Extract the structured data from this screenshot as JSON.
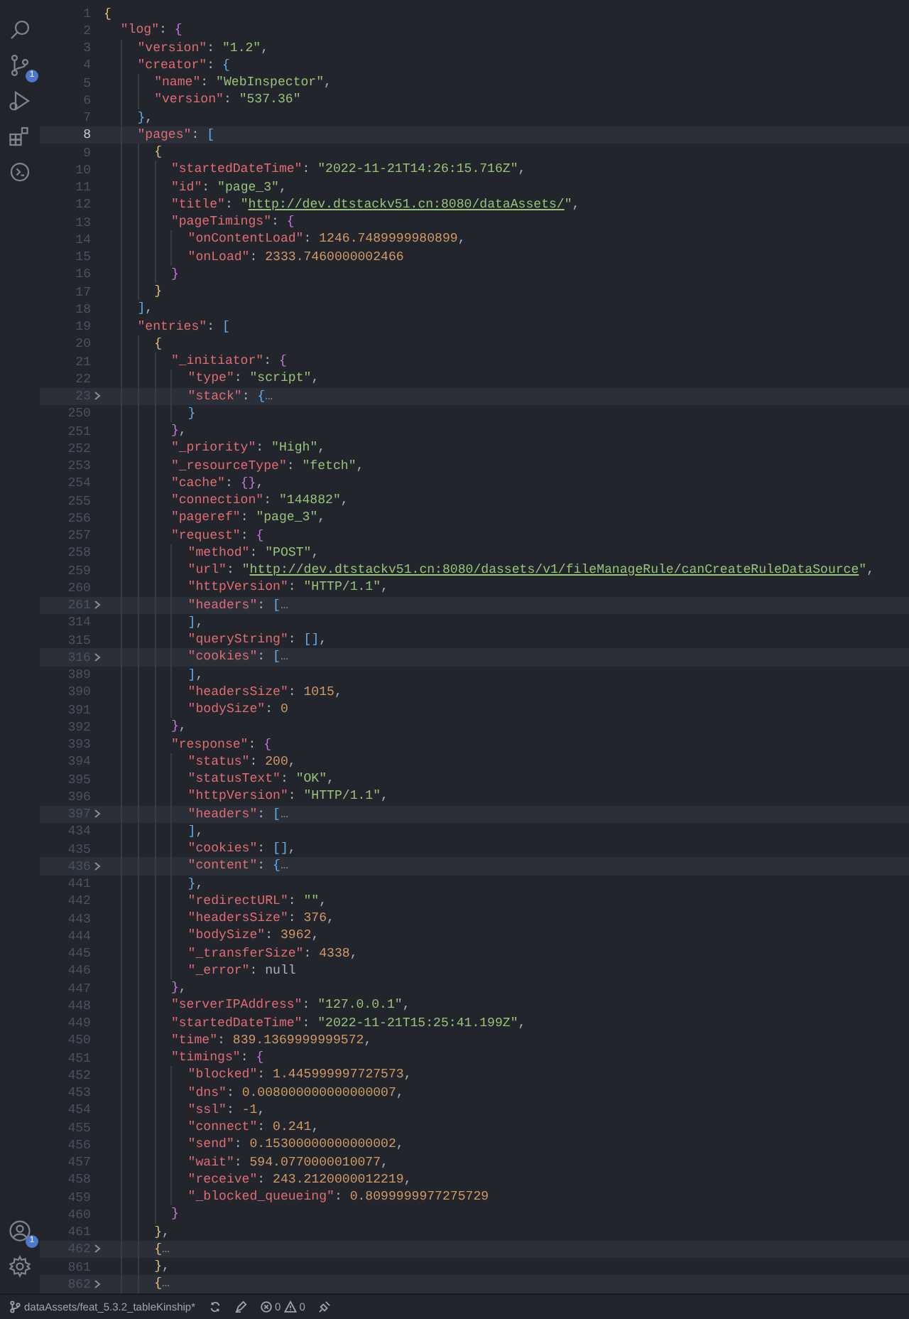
{
  "activity_bar": {
    "top": [
      {
        "kind": "search"
      },
      {
        "kind": "source-control",
        "badge": "1"
      },
      {
        "kind": "run-debug"
      },
      {
        "kind": "extensions"
      },
      {
        "kind": "remote"
      }
    ],
    "bottom": [
      {
        "kind": "account",
        "badge": "1"
      },
      {
        "kind": "settings"
      }
    ]
  },
  "editor": {
    "lines": [
      {
        "number": "1",
        "text": "{",
        "current": false,
        "folded": false
      },
      {
        "number": "2",
        "text": "  \"log\": {",
        "current": false,
        "folded": false
      },
      {
        "number": "3",
        "text": "    \"version\": \"1.2\",",
        "current": false,
        "folded": false
      },
      {
        "number": "4",
        "text": "    \"creator\": {",
        "current": false,
        "folded": false
      },
      {
        "number": "5",
        "text": "      \"name\": \"WebInspector\",",
        "current": false,
        "folded": false
      },
      {
        "number": "6",
        "text": "      \"version\": \"537.36\"",
        "current": false,
        "folded": false
      },
      {
        "number": "7",
        "text": "    },",
        "current": false,
        "folded": false
      },
      {
        "number": "8",
        "text": "    \"pages\": [",
        "current": true,
        "folded": false
      },
      {
        "number": "9",
        "text": "      {",
        "current": false,
        "folded": false
      },
      {
        "number": "10",
        "text": "        \"startedDateTime\": \"2022-11-21T14:26:15.716Z\",",
        "current": false,
        "folded": false
      },
      {
        "number": "11",
        "text": "        \"id\": \"page_3\",",
        "current": false,
        "folded": false
      },
      {
        "number": "12",
        "text": "        \"title\": \"http://dev.dtstackv51.cn:8080/dataAssets/\",",
        "current": false,
        "folded": false
      },
      {
        "number": "13",
        "text": "        \"pageTimings\": {",
        "current": false,
        "folded": false
      },
      {
        "number": "14",
        "text": "          \"onContentLoad\": 1246.7489999980899,",
        "current": false,
        "folded": false
      },
      {
        "number": "15",
        "text": "          \"onLoad\": 2333.7460000002466",
        "current": false,
        "folded": false
      },
      {
        "number": "16",
        "text": "        }",
        "current": false,
        "folded": false
      },
      {
        "number": "17",
        "text": "      }",
        "current": false,
        "folded": false
      },
      {
        "number": "18",
        "text": "    ],",
        "current": false,
        "folded": false
      },
      {
        "number": "19",
        "text": "    \"entries\": [",
        "current": false,
        "folded": false
      },
      {
        "number": "20",
        "text": "      {",
        "current": false,
        "folded": false
      },
      {
        "number": "21",
        "text": "        \"_initiator\": {",
        "current": false,
        "folded": false
      },
      {
        "number": "22",
        "text": "          \"type\": \"script\",",
        "current": false,
        "folded": false
      },
      {
        "number": "23",
        "text": "          \"stack\": {…",
        "current": false,
        "folded": true
      },
      {
        "number": "250",
        "text": "          }",
        "current": false,
        "folded": false
      },
      {
        "number": "251",
        "text": "        },",
        "current": false,
        "folded": false
      },
      {
        "number": "252",
        "text": "        \"_priority\": \"High\",",
        "current": false,
        "folded": false
      },
      {
        "number": "253",
        "text": "        \"_resourceType\": \"fetch\",",
        "current": false,
        "folded": false
      },
      {
        "number": "254",
        "text": "        \"cache\": {},",
        "current": false,
        "folded": false
      },
      {
        "number": "255",
        "text": "        \"connection\": \"144882\",",
        "current": false,
        "folded": false
      },
      {
        "number": "256",
        "text": "        \"pageref\": \"page_3\",",
        "current": false,
        "folded": false
      },
      {
        "number": "257",
        "text": "        \"request\": {",
        "current": false,
        "folded": false
      },
      {
        "number": "258",
        "text": "          \"method\": \"POST\",",
        "current": false,
        "folded": false
      },
      {
        "number": "259",
        "text": "          \"url\": \"http://dev.dtstackv51.cn:8080/dassets/v1/fileManageRule/canCreateRuleDataSource\",",
        "current": false,
        "folded": false
      },
      {
        "number": "260",
        "text": "          \"httpVersion\": \"HTTP/1.1\",",
        "current": false,
        "folded": false
      },
      {
        "number": "261",
        "text": "          \"headers\": […",
        "current": false,
        "folded": true
      },
      {
        "number": "314",
        "text": "          ],",
        "current": false,
        "folded": false
      },
      {
        "number": "315",
        "text": "          \"queryString\": [],",
        "current": false,
        "folded": false
      },
      {
        "number": "316",
        "text": "          \"cookies\": […",
        "current": false,
        "folded": true
      },
      {
        "number": "389",
        "text": "          ],",
        "current": false,
        "folded": false
      },
      {
        "number": "390",
        "text": "          \"headersSize\": 1015,",
        "current": false,
        "folded": false
      },
      {
        "number": "391",
        "text": "          \"bodySize\": 0",
        "current": false,
        "folded": false
      },
      {
        "number": "392",
        "text": "        },",
        "current": false,
        "folded": false
      },
      {
        "number": "393",
        "text": "        \"response\": {",
        "current": false,
        "folded": false
      },
      {
        "number": "394",
        "text": "          \"status\": 200,",
        "current": false,
        "folded": false
      },
      {
        "number": "395",
        "text": "          \"statusText\": \"OK\",",
        "current": false,
        "folded": false
      },
      {
        "number": "396",
        "text": "          \"httpVersion\": \"HTTP/1.1\",",
        "current": false,
        "folded": false
      },
      {
        "number": "397",
        "text": "          \"headers\": […",
        "current": false,
        "folded": true
      },
      {
        "number": "434",
        "text": "          ],",
        "current": false,
        "folded": false
      },
      {
        "number": "435",
        "text": "          \"cookies\": [],",
        "current": false,
        "folded": false
      },
      {
        "number": "436",
        "text": "          \"content\": {…",
        "current": false,
        "folded": true
      },
      {
        "number": "441",
        "text": "          },",
        "current": false,
        "folded": false
      },
      {
        "number": "442",
        "text": "          \"redirectURL\": \"\",",
        "current": false,
        "folded": false
      },
      {
        "number": "443",
        "text": "          \"headersSize\": 376,",
        "current": false,
        "folded": false
      },
      {
        "number": "444",
        "text": "          \"bodySize\": 3962,",
        "current": false,
        "folded": false
      },
      {
        "number": "445",
        "text": "          \"_transferSize\": 4338,",
        "current": false,
        "folded": false
      },
      {
        "number": "446",
        "text": "          \"_error\": null",
        "current": false,
        "folded": false
      },
      {
        "number": "447",
        "text": "        },",
        "current": false,
        "folded": false
      },
      {
        "number": "448",
        "text": "        \"serverIPAddress\": \"127.0.0.1\",",
        "current": false,
        "folded": false
      },
      {
        "number": "449",
        "text": "        \"startedDateTime\": \"2022-11-21T15:25:41.199Z\",",
        "current": false,
        "folded": false
      },
      {
        "number": "450",
        "text": "        \"time\": 839.1369999999572,",
        "current": false,
        "folded": false
      },
      {
        "number": "451",
        "text": "        \"timings\": {",
        "current": false,
        "folded": false
      },
      {
        "number": "452",
        "text": "          \"blocked\": 1.445999997727573,",
        "current": false,
        "folded": false
      },
      {
        "number": "453",
        "text": "          \"dns\": 0.008000000000000007,",
        "current": false,
        "folded": false
      },
      {
        "number": "454",
        "text": "          \"ssl\": -1,",
        "current": false,
        "folded": false
      },
      {
        "number": "455",
        "text": "          \"connect\": 0.241,",
        "current": false,
        "folded": false
      },
      {
        "number": "456",
        "text": "          \"send\": 0.15300000000000002,",
        "current": false,
        "folded": false
      },
      {
        "number": "457",
        "text": "          \"wait\": 594.0770000010077,",
        "current": false,
        "folded": false
      },
      {
        "number": "458",
        "text": "          \"receive\": 243.2120000012219,",
        "current": false,
        "folded": false
      },
      {
        "number": "459",
        "text": "          \"_blocked_queueing\": 0.8099999977275729",
        "current": false,
        "folded": false
      },
      {
        "number": "460",
        "text": "        }",
        "current": false,
        "folded": false
      },
      {
        "number": "461",
        "text": "      },",
        "current": false,
        "folded": false
      },
      {
        "number": "462",
        "text": "      {…",
        "current": false,
        "folded": true
      },
      {
        "number": "861",
        "text": "      },",
        "current": false,
        "folded": false
      },
      {
        "number": "862",
        "text": "      {…",
        "current": false,
        "folded": true
      }
    ]
  },
  "status_bar": {
    "branch": "dataAssets/feat_5.3.2_tableKinship*",
    "errors": "0",
    "warnings": "0"
  }
}
